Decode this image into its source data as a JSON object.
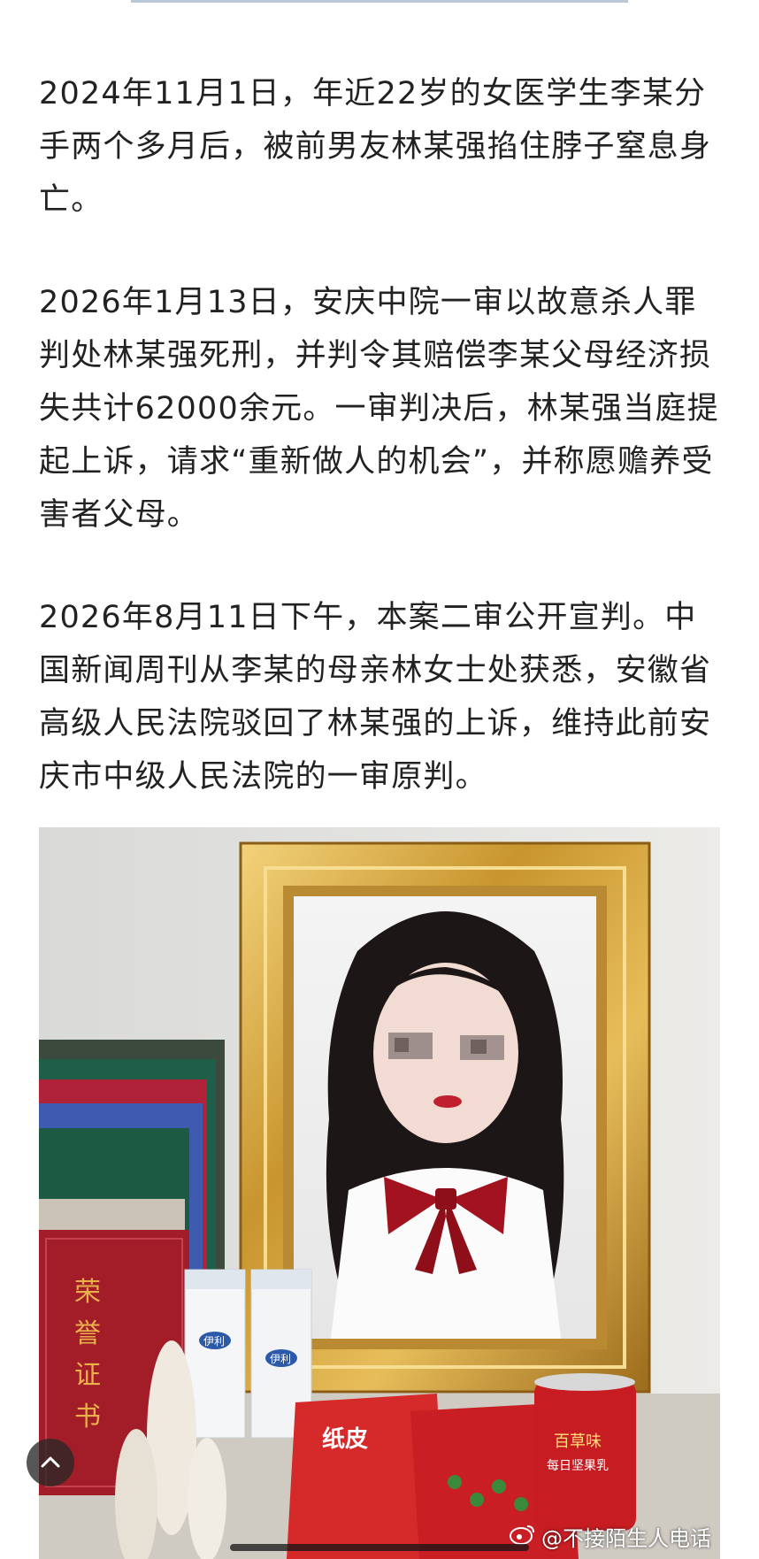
{
  "article": {
    "paragraphs": [
      "2024年11月1日，年近22岁的女医学生李某分手两个多月后，被前男友林某强掐住脖子窒息身亡。",
      "2026年1月13日，安庆中院一审以故意杀人罪判处林某强死刑，并判令其赔偿李某父母经济损失共计62000余元。一审判决后，林某强当庭提起上诉，请求“重新做人的机会”，并称愿赡养受害者父母。",
      "2026年8月11日下午，本案二审公开宣判。中国新闻周刊从李某的母亲林女士处获悉，安徽省高级人民法院驳回了林某强的上诉，维持此前安庆市中级人民法院的一审原判。"
    ]
  },
  "photo": {
    "certificate_text": "荣誉证书",
    "milk_brand": "伊利",
    "snack_bag_text": "纸皮",
    "can_text": "百草味 每日坚果乳"
  },
  "watermark": {
    "text": "@不接陌生人电话"
  },
  "icons": {
    "back_to_top": "chevron-up-icon",
    "weibo": "weibo-logo-icon"
  }
}
